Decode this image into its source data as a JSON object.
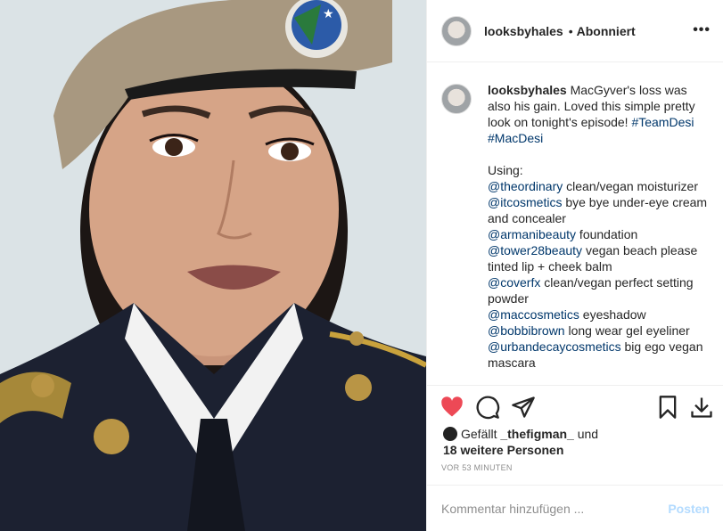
{
  "header": {
    "username": "looksbyhales",
    "separator": "•",
    "status": "Abonniert",
    "more_icon": "more-dots-icon"
  },
  "caption": {
    "username": "looksbyhales",
    "lines": [
      {
        "text": "MacGyver's loss was also his gain. Loved this simple pretty look on tonight's episode! "
      },
      {
        "link1": "#TeamDesi",
        "link2": "#MacDesi"
      }
    ],
    "using_label": "Using:",
    "products": [
      {
        "handle": "@theordinary",
        "desc": " clean/vegan moisturizer"
      },
      {
        "handle": "@itcosmetics",
        "desc": " bye bye under-eye cream and concealer"
      },
      {
        "handle": "@armanibeauty",
        "desc": " foundation"
      },
      {
        "handle": "@tower28beauty",
        "desc": " vegan beach please tinted lip + cheek balm"
      },
      {
        "handle": "@coverfx",
        "desc": " clean/vegan perfect setting powder"
      },
      {
        "handle": "@maccosmetics",
        "desc": " eyeshadow"
      },
      {
        "handle": "@bobbibrown",
        "desc": " long wear gel eyeliner"
      },
      {
        "handle": "@urbandecaycosmetics",
        "desc": " big ego vegan mascara"
      }
    ]
  },
  "actions": {
    "like_icon": "heart-filled-icon",
    "comment_icon": "comment-icon",
    "share_icon": "share-icon",
    "save_icon": "bookmark-icon",
    "download_icon": "download-icon",
    "like_color": "#ed4956"
  },
  "likes": {
    "prefix": "Gefällt ",
    "user": "_thefigman_",
    "mid": " und",
    "others": "18 weitere Personen"
  },
  "timestamp": "VOR 53 MINUTEN",
  "comment": {
    "placeholder": "Kommentar hinzufügen ...",
    "post_label": "Posten"
  }
}
